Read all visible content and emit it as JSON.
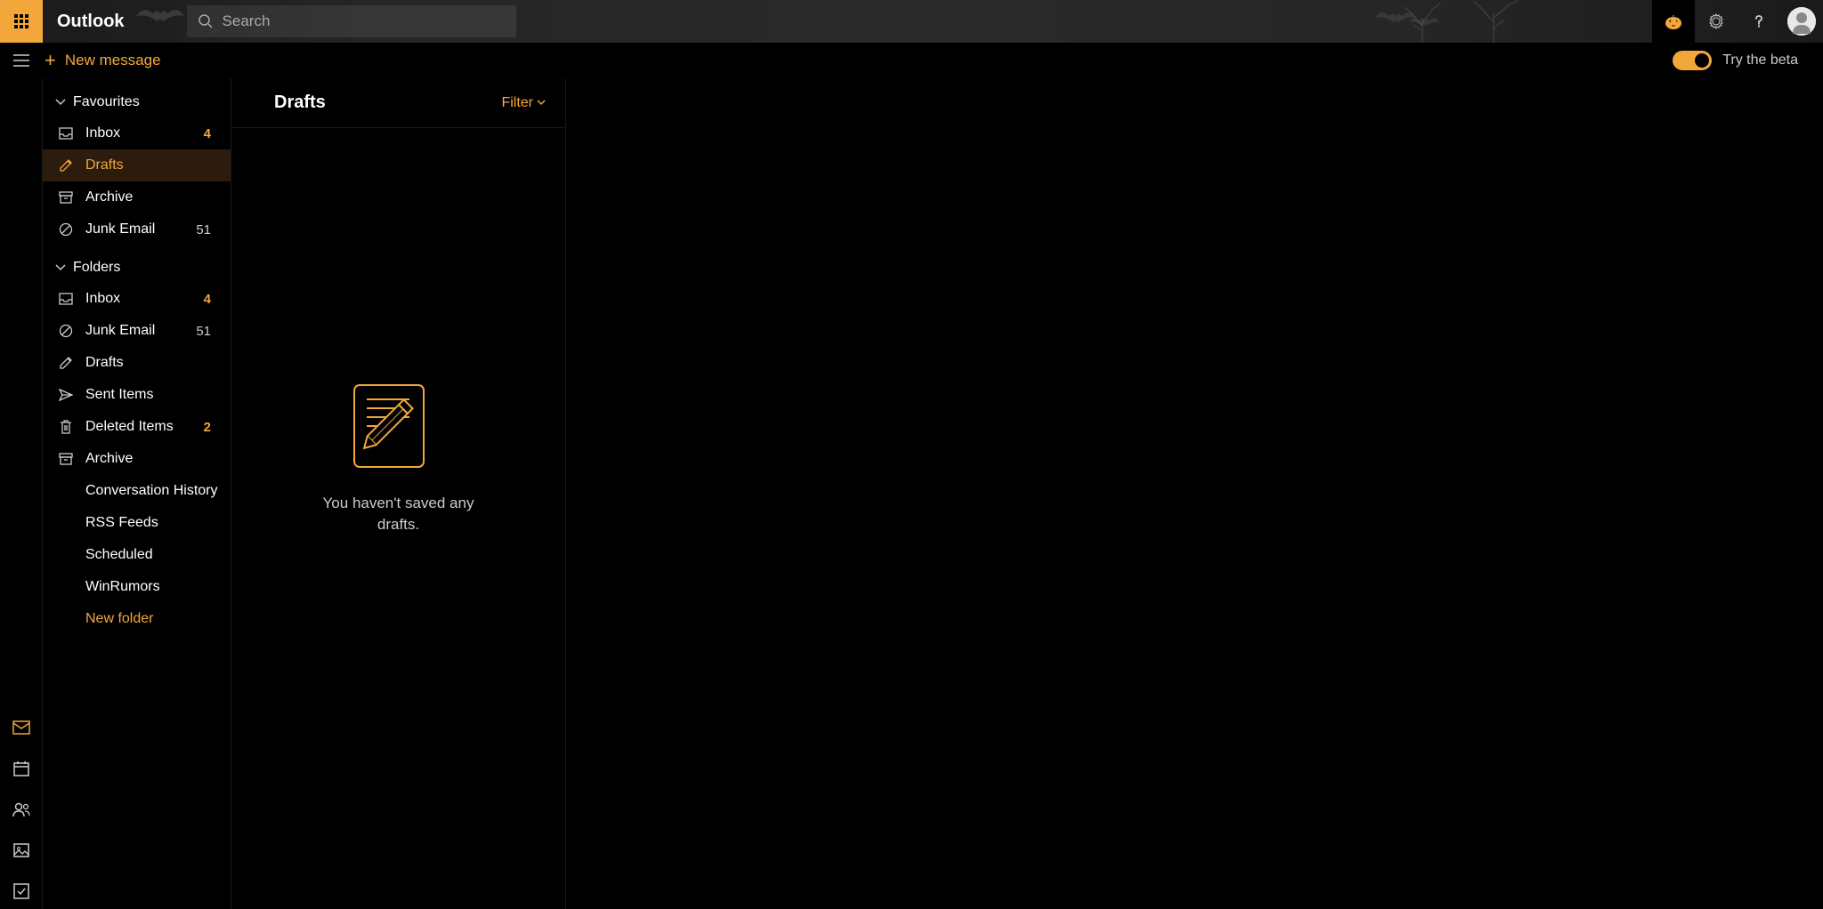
{
  "header": {
    "app_title": "Outlook",
    "search_placeholder": "Search"
  },
  "toolbar": {
    "new_message_label": "New message",
    "beta_label": "Try the beta"
  },
  "sidebar": {
    "favourites_label": "Favourites",
    "folders_label": "Folders",
    "favourites": [
      {
        "label": "Inbox",
        "count": "4",
        "highlight": true,
        "icon": "inbox"
      },
      {
        "label": "Drafts",
        "count": "",
        "highlight": false,
        "icon": "edit",
        "selected": true
      },
      {
        "label": "Archive",
        "count": "",
        "highlight": false,
        "icon": "archive"
      },
      {
        "label": "Junk Email",
        "count": "51",
        "highlight": false,
        "icon": "blocked"
      }
    ],
    "folders": [
      {
        "label": "Inbox",
        "count": "4",
        "highlight": true,
        "icon": "inbox"
      },
      {
        "label": "Junk Email",
        "count": "51",
        "highlight": false,
        "icon": "blocked"
      },
      {
        "label": "Drafts",
        "count": "",
        "highlight": false,
        "icon": "edit"
      },
      {
        "label": "Sent Items",
        "count": "",
        "highlight": false,
        "icon": "send"
      },
      {
        "label": "Deleted Items",
        "count": "2",
        "highlight": true,
        "icon": "trash"
      },
      {
        "label": "Archive",
        "count": "",
        "highlight": false,
        "icon": "archive"
      }
    ],
    "subfolders": [
      {
        "label": "Conversation History"
      },
      {
        "label": "RSS Feeds"
      },
      {
        "label": "Scheduled"
      },
      {
        "label": "WinRumors"
      }
    ],
    "new_folder_label": "New folder"
  },
  "list": {
    "title": "Drafts",
    "filter_label": "Filter",
    "empty_text": "You haven't saved any drafts."
  }
}
